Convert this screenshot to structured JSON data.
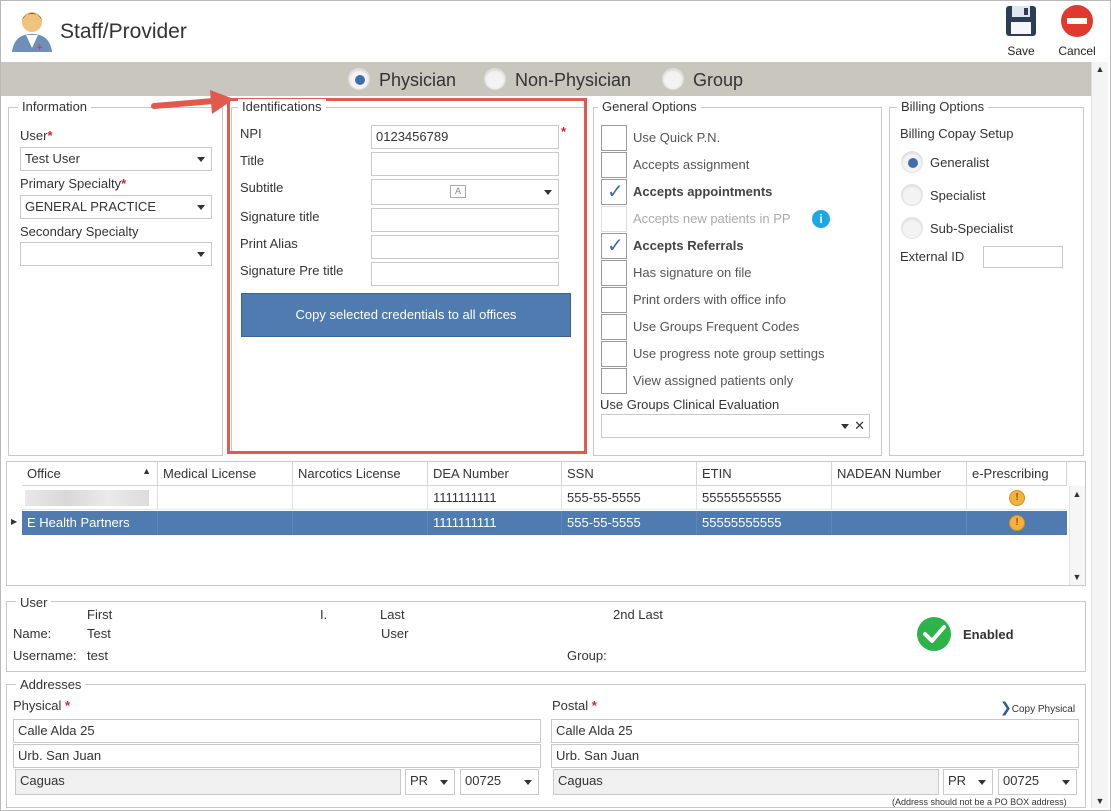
{
  "header": {
    "title": "Staff/Provider",
    "save_label": "Save",
    "cancel_label": "Cancel"
  },
  "provider_type": {
    "options": [
      "Physician",
      "Non-Physician",
      "Group"
    ],
    "selected": "Physician"
  },
  "information": {
    "legend": "Information",
    "user_label": "User",
    "user_value": "Test User",
    "primary_specialty_label": "Primary Specialty",
    "primary_specialty_value": "GENERAL PRACTICE",
    "secondary_specialty_label": "Secondary Specialty",
    "secondary_specialty_value": ""
  },
  "identifications": {
    "legend": "Identifications",
    "npi_label": "NPI",
    "npi_value": "0123456789",
    "title_label": "Title",
    "title_value": "",
    "subtitle_label": "Subtitle",
    "subtitle_value": "",
    "signature_title_label": "Signature title",
    "signature_title_value": "",
    "print_alias_label": "Print Alias",
    "print_alias_value": "",
    "signature_pre_title_label": "Signature Pre title",
    "signature_pre_title_value": "",
    "copy_button_label": "Copy selected credentials to all offices"
  },
  "general_options": {
    "legend": "General Options",
    "items": [
      {
        "label": "Use Quick P.N.",
        "checked": false,
        "bold": false,
        "disabled": false
      },
      {
        "label": "Accepts assignment",
        "checked": false,
        "bold": false,
        "disabled": false
      },
      {
        "label": "Accepts appointments",
        "checked": true,
        "bold": true,
        "disabled": false
      },
      {
        "label": "Accepts new patients in PP",
        "checked": false,
        "bold": false,
        "disabled": true
      },
      {
        "label": "Accepts Referrals",
        "checked": true,
        "bold": true,
        "disabled": false
      },
      {
        "label": "Has signature on file",
        "checked": false,
        "bold": false,
        "disabled": false
      },
      {
        "label": "Print orders with office info",
        "checked": false,
        "bold": false,
        "disabled": false
      },
      {
        "label": "Use Groups Frequent Codes",
        "checked": false,
        "bold": false,
        "disabled": false
      },
      {
        "label": "Use progress note group settings",
        "checked": false,
        "bold": false,
        "disabled": false
      },
      {
        "label": "View assigned patients only",
        "checked": false,
        "bold": false,
        "disabled": false
      }
    ],
    "clinical_eval_label": "Use Groups Clinical Evaluation",
    "clinical_eval_value": ""
  },
  "billing_options": {
    "legend": "Billing Options",
    "copay_setup_label": "Billing Copay Setup",
    "options": [
      "Generalist",
      "Specialist",
      "Sub-Specialist"
    ],
    "selected": "Generalist",
    "external_id_label": "External ID",
    "external_id_value": ""
  },
  "offices_grid": {
    "columns": [
      "Office",
      "Medical License",
      "Narcotics License",
      "DEA Number",
      "SSN",
      "ETIN",
      "NADEAN Number",
      "e-Prescribing"
    ],
    "rows": [
      {
        "office": "",
        "medical_license": "",
        "narcotics_license": "",
        "dea": "1111111111",
        "ssn": "555-55-5555",
        "etin": "55555555555",
        "nadean": "",
        "selected": false
      },
      {
        "office": "E Health Partners",
        "medical_license": "",
        "narcotics_license": "",
        "dea": "1111111111",
        "ssn": "555-55-5555",
        "etin": "55555555555",
        "nadean": "",
        "selected": true
      }
    ]
  },
  "user_section": {
    "legend": "User",
    "first_header": "First",
    "initial_header": "I.",
    "last_header": "Last",
    "second_last_header": "2nd Last",
    "name_label": "Name:",
    "first_value": "Test",
    "last_value": "User",
    "username_label": "Username:",
    "username_value": "test",
    "group_label": "Group:",
    "group_value": "",
    "status": "Enabled"
  },
  "addresses": {
    "legend": "Addresses",
    "physical_label": "Physical",
    "postal_label": "Postal",
    "copy_physical_label": "Copy Physical",
    "physical": {
      "line1": "Calle Alda 25",
      "line2": "Urb. San Juan",
      "city": "Caguas",
      "state": "PR",
      "zip": "00725"
    },
    "postal": {
      "line1": "Calle Alda 25",
      "line2": "Urb. San Juan",
      "city": "Caguas",
      "state": "PR",
      "zip": "00725"
    },
    "note": "(Address should not be a PO BOX address)"
  },
  "colors": {
    "accent_blue": "#4f7bb0",
    "highlight_red": "#e05a4e",
    "band_gray": "#c9c6bd",
    "enabled_green": "#2eb34a",
    "required_red": "#d9232d"
  }
}
